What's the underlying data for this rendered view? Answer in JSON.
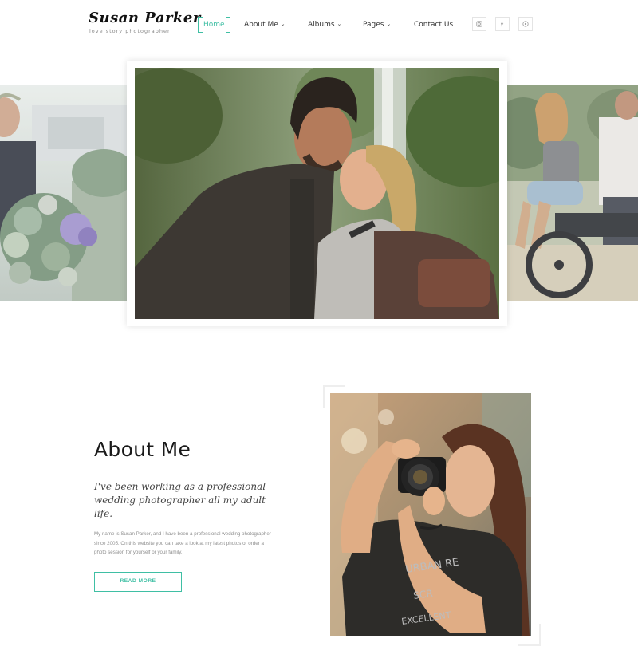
{
  "brand": {
    "name": "Susan Parker",
    "tagline": "love story photographer"
  },
  "nav": {
    "items": [
      {
        "label": "Home",
        "active": true,
        "dropdown": false
      },
      {
        "label": "About Me",
        "active": false,
        "dropdown": true
      },
      {
        "label": "Albums",
        "active": false,
        "dropdown": true
      },
      {
        "label": "Pages",
        "active": false,
        "dropdown": true
      },
      {
        "label": "Contact Us",
        "active": false,
        "dropdown": false
      }
    ],
    "social": [
      "instagram-icon",
      "facebook-icon",
      "pinterest-icon"
    ]
  },
  "gallery": {
    "images": [
      {
        "subject": "bridal-bouquet-photo"
      },
      {
        "subject": "couple-smiling-photo"
      },
      {
        "subject": "couple-motorcycle-photo"
      }
    ]
  },
  "about": {
    "title": "About Me",
    "lead": "I've been working as a professional wedding photographer all my adult life.",
    "body": "My name is Susan Parker, and I have been a professional wedding photographer since 2005. On this website you can take a look at my latest photos or order a photo session for yourself or your family.",
    "button": "READ MORE",
    "camera_text": "URBAN RE SCR EXCELLENT"
  },
  "colors": {
    "accent": "#3fbfa4",
    "text": "#1a1a1a",
    "muted": "#8f8f8f"
  }
}
